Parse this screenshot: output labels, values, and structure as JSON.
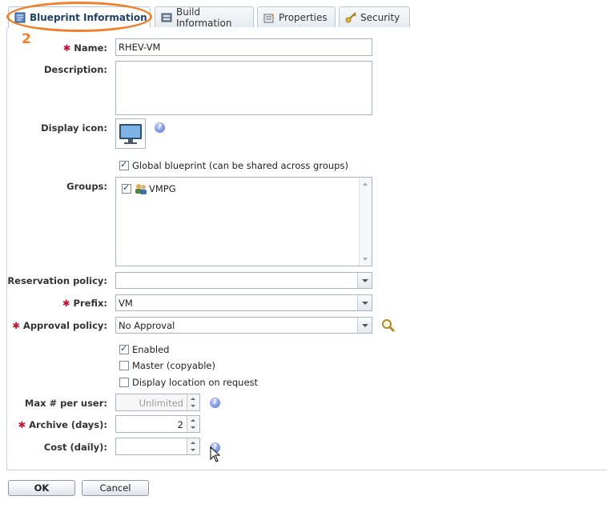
{
  "tabs": [
    {
      "label": "Blueprint Information",
      "icon": "blueprint-icon",
      "active": true
    },
    {
      "label": "Build Information",
      "icon": "build-icon",
      "active": false
    },
    {
      "label": "Properties",
      "icon": "properties-icon",
      "active": false
    },
    {
      "label": "Security",
      "icon": "key-icon",
      "active": false
    }
  ],
  "annotation": {
    "number": "2",
    "color": "#f07f2c"
  },
  "form": {
    "name": {
      "label": "Name:",
      "value": "RHEV-VM",
      "required": true
    },
    "description": {
      "label": "Description:",
      "value": ""
    },
    "display_icon": {
      "label": "Display icon:",
      "icon": "monitor-icon"
    },
    "global_blueprint": {
      "label": "Global blueprint (can be shared across groups)",
      "checked": true
    },
    "groups": {
      "label": "Groups:",
      "items": [
        {
          "label": "VMPG",
          "checked": true
        }
      ]
    },
    "reservation_policy": {
      "label": "Reservation policy:",
      "value": ""
    },
    "prefix": {
      "label": "Prefix:",
      "value": "VM",
      "required": true
    },
    "approval_policy": {
      "label": "Approval policy:",
      "value": "No Approval",
      "required": true
    },
    "enabled": {
      "label": "Enabled",
      "checked": true
    },
    "master": {
      "label": "Master (copyable)",
      "checked": false
    },
    "display_location": {
      "label": "Display location on request",
      "checked": false
    },
    "max_per_user": {
      "label": "Max # per user:",
      "value": "Unlimited"
    },
    "archive_days": {
      "label": "Archive (days):",
      "value": "2",
      "required": true
    },
    "cost_daily": {
      "label": "Cost (daily):",
      "value": ""
    },
    "required_marker": "✱"
  },
  "buttons": {
    "ok": "OK",
    "cancel": "Cancel"
  },
  "colors": {
    "accent": "#1f3f6e",
    "required": "#c8102e",
    "annotation": "#f07f2c"
  }
}
